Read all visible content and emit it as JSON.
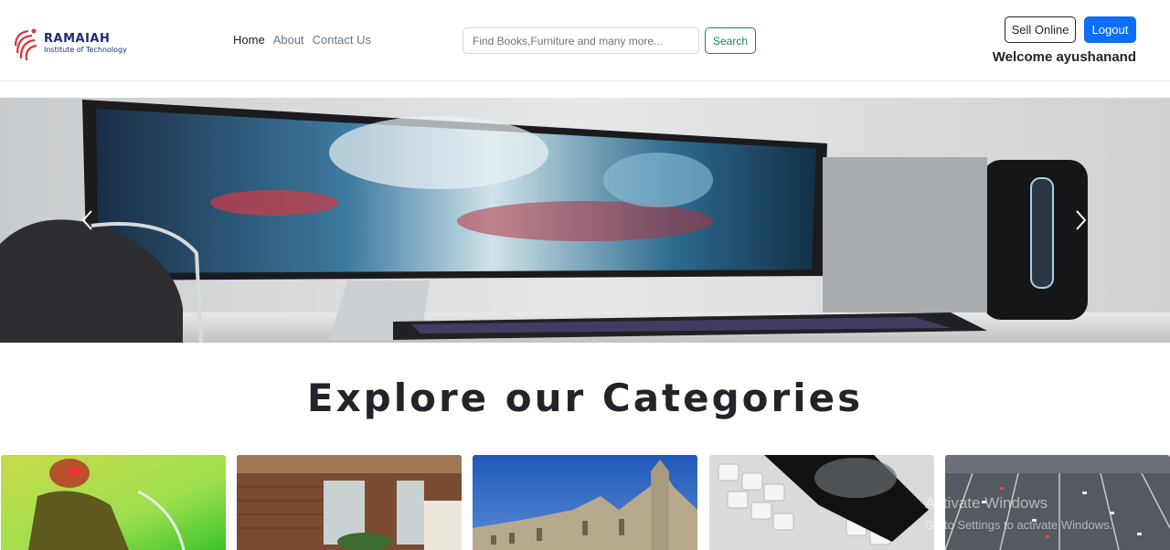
{
  "brand": {
    "name": "RAMAIAH",
    "subtitle": "Institute of Technology"
  },
  "nav": {
    "links": [
      {
        "label": "Home",
        "active": true
      },
      {
        "label": "About",
        "active": false
      },
      {
        "label": "Contact Us",
        "active": false
      }
    ]
  },
  "search": {
    "placeholder": "Find Books,Furniture and many more...",
    "value": "",
    "button_label": "Search"
  },
  "account": {
    "sell_label": "Sell Online",
    "logout_label": "Logout",
    "welcome_text": "Welcome ayushanand"
  },
  "carousel": {
    "prev_icon": "chevron-left-icon",
    "next_icon": "chevron-right-icon"
  },
  "categories": {
    "heading": "Explore our Categories",
    "cards": 5
  },
  "watermark": {
    "line1": "Activate Windows",
    "line2": "Go to Settings to activate Windows."
  },
  "colors": {
    "primary": "#0d6efd",
    "success": "#198754",
    "brand": "#1e2a78",
    "brand_accent": "#d9383a"
  }
}
